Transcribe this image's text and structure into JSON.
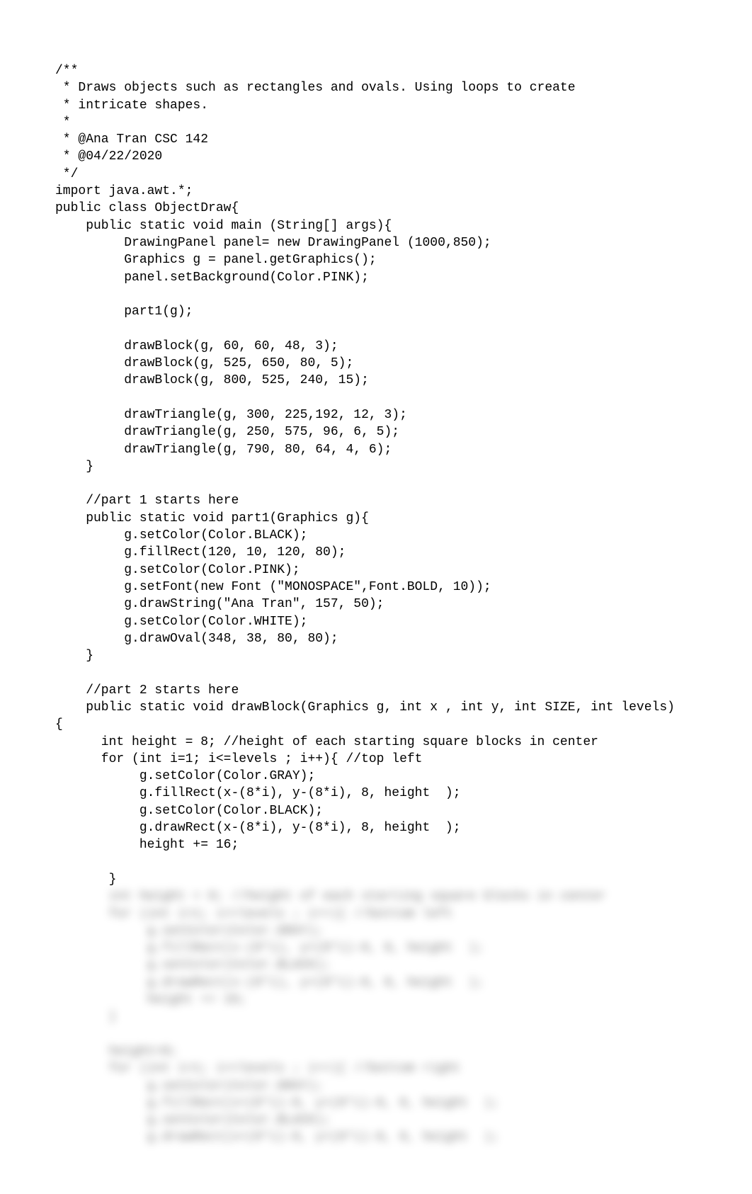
{
  "code_clear": "/**\n * Draws objects such as rectangles and ovals. Using loops to create\n * intricate shapes.\n *\n * @Ana Tran CSC 142\n * @04/22/2020\n */\nimport java.awt.*;\npublic class ObjectDraw{\n    public static void main (String[] args){\n         DrawingPanel panel= new DrawingPanel (1000,850);\n         Graphics g = panel.getGraphics();\n         panel.setBackground(Color.PINK);\n\n         part1(g);\n\n         drawBlock(g, 60, 60, 48, 3);\n         drawBlock(g, 525, 650, 80, 5);\n         drawBlock(g, 800, 525, 240, 15);\n\n         drawTriangle(g, 300, 225,192, 12, 3);\n         drawTriangle(g, 250, 575, 96, 6, 5);\n         drawTriangle(g, 790, 80, 64, 4, 6);\n    }\n\n    //part 1 starts here\n    public static void part1(Graphics g){\n         g.setColor(Color.BLACK);\n         g.fillRect(120, 10, 120, 80);\n         g.setColor(Color.PINK);\n         g.setFont(new Font (\"MONOSPACE\",Font.BOLD, 10));\n         g.drawString(\"Ana Tran\", 157, 50);\n         g.setColor(Color.WHITE);\n         g.drawOval(348, 38, 80, 80);\n    }\n\n    //part 2 starts here\n    public static void drawBlock(Graphics g, int x , int y, int SIZE, int levels)\n{\n      int height = 8; //height of each starting square blocks in center\n      for (int i=1; i<=levels ; i++){ //top left\n           g.setColor(Color.GRAY);\n           g.fillRect(x-(8*i), y-(8*i), 8, height  );\n           g.setColor(Color.BLACK);\n           g.drawRect(x-(8*i), y-(8*i), 8, height  );\n           height += 16;\n\n       }\n",
  "code_blurred": "       int height = 8; //height of each starting square blocks in center\n       for (int i=1; i<=levels ; i++){ //bottom left\n            g.setColor(Color.GRAY);\n            g.fillRect(x-(8*i), y+(8*i)-8, 8, height  );\n            g.setColor(Color.BLACK);\n            g.drawRect(x-(8*i), y+(8*i)-8, 8, height  );\n            height += 16;\n       }\n\n       height=8;\n       for (int i=1; i<=levels ; i++){ //bottom right\n            g.setColor(Color.GRAY);\n            g.fillRect(x+(8*i)-8, y+(8*i)-8, 8, height  );\n            g.setColor(Color.BLACK);\n            g.drawRect(x+(8*i)-8, y+(8*i)-8, 8, height  );"
}
